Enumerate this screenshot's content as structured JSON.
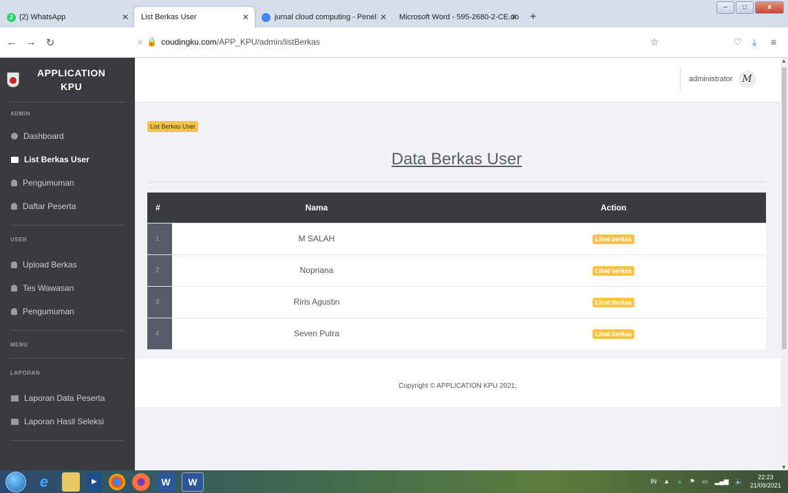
{
  "browser": {
    "tabs": [
      {
        "label": "(2) WhatsApp",
        "badge": "2"
      },
      {
        "label": "List Berkas User"
      },
      {
        "label": "jurnal cloud computing - Penel"
      },
      {
        "label": "Microsoft Word - 595-2680-2-CE.do"
      }
    ],
    "url_domain": "coudingku.com",
    "url_path": "/APP_KPU/admin/listBerkas"
  },
  "sidebar": {
    "brand_line1": "APPLICATION",
    "brand_line2": "KPU",
    "admin_heading": "ADMIN",
    "admin_items": [
      {
        "label": "Dashboard"
      },
      {
        "label": "List Berkas User"
      },
      {
        "label": "Pengumuman"
      },
      {
        "label": "Daftar Peserta"
      }
    ],
    "user_heading": "USER",
    "user_items": [
      {
        "label": "Upload Berkas"
      },
      {
        "label": "Tes Wawasan"
      },
      {
        "label": "Pengumuman"
      }
    ],
    "menu_heading": "MENU",
    "laporan_heading": "LAPORAN",
    "laporan_items": [
      {
        "label": "Laporan Data Peserta"
      },
      {
        "label": "Laporan Hasil Seleksi"
      }
    ]
  },
  "topbar": {
    "username": "administrator",
    "avatar_text": "M"
  },
  "main": {
    "breadcrumb": "List Berkas User",
    "title": "Data Berkas User",
    "table": {
      "headers": [
        "#",
        "Nama",
        "Action"
      ],
      "rows": [
        {
          "num": "1",
          "nama": "M SALAH",
          "action": "Lihat berkas"
        },
        {
          "num": "2",
          "nama": "Nopriana",
          "action": "Lihat berkas"
        },
        {
          "num": "3",
          "nama": "Riris Agustin",
          "action": "Lihat berkas"
        },
        {
          "num": "4",
          "nama": "Seven Putra",
          "action": "Lihat berkas"
        }
      ]
    },
    "footer": "Copyright © APPLICATION KPU 2021;"
  },
  "taskbar": {
    "lang": "IN",
    "time": "22:23",
    "date": "21/09/2021"
  }
}
